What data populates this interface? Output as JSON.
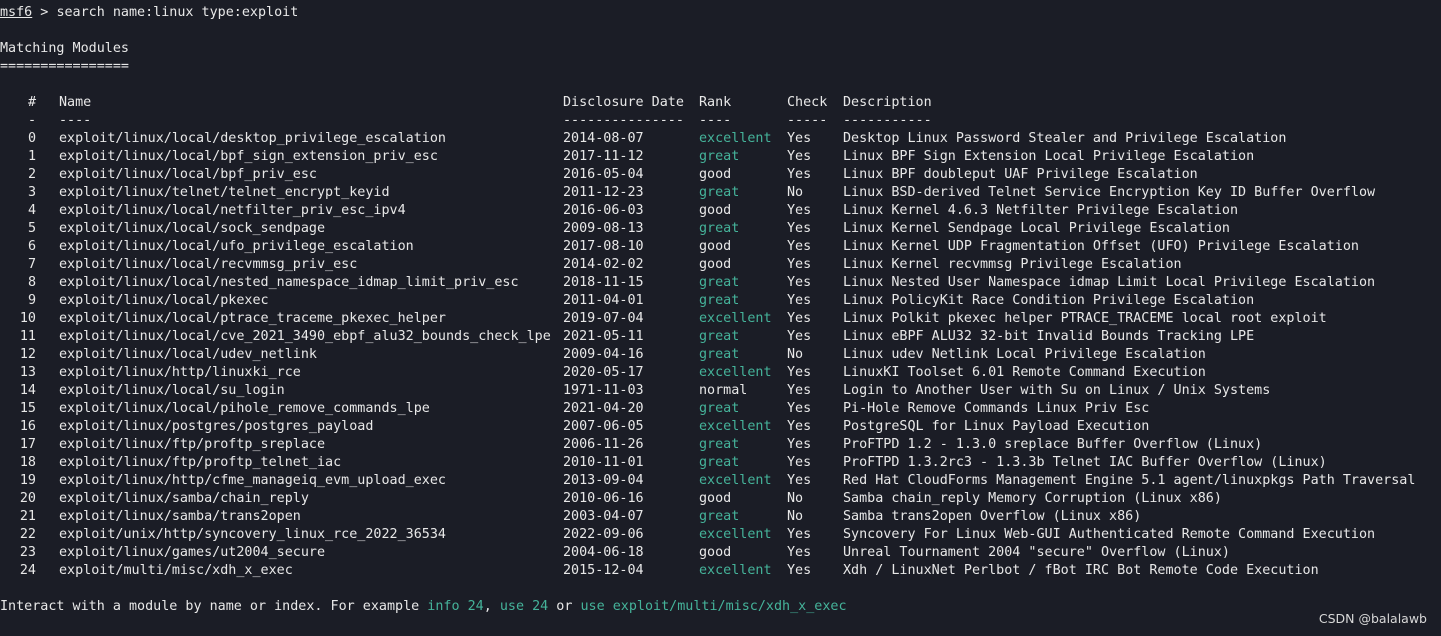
{
  "prompt": {
    "name": "msf6",
    "separator": " > ",
    "command": "search name:linux type:exploit"
  },
  "section": {
    "title": "Matching Modules",
    "underline": "================"
  },
  "table": {
    "headers": {
      "idx": "#",
      "name": "Name",
      "date": "Disclosure Date",
      "rank": "Rank",
      "check": "Check",
      "desc": "Description"
    },
    "dividers": {
      "idx": "-",
      "name": "----",
      "date": "---------------",
      "rank": "----",
      "check": "-----",
      "desc": "-----------"
    },
    "rows": [
      {
        "idx": "0",
        "name": "exploit/linux/local/desktop_privilege_escalation",
        "date": "2014-08-07",
        "rank": "excellent",
        "check": "Yes",
        "desc": "Desktop Linux Password Stealer and Privilege Escalation"
      },
      {
        "idx": "1",
        "name": "exploit/linux/local/bpf_sign_extension_priv_esc",
        "date": "2017-11-12",
        "rank": "great",
        "check": "Yes",
        "desc": "Linux BPF Sign Extension Local Privilege Escalation"
      },
      {
        "idx": "2",
        "name": "exploit/linux/local/bpf_priv_esc",
        "date": "2016-05-04",
        "rank": "good",
        "check": "Yes",
        "desc": "Linux BPF doubleput UAF Privilege Escalation"
      },
      {
        "idx": "3",
        "name": "exploit/linux/telnet/telnet_encrypt_keyid",
        "date": "2011-12-23",
        "rank": "great",
        "check": "No",
        "desc": "Linux BSD-derived Telnet Service Encryption Key ID Buffer Overflow"
      },
      {
        "idx": "4",
        "name": "exploit/linux/local/netfilter_priv_esc_ipv4",
        "date": "2016-06-03",
        "rank": "good",
        "check": "Yes",
        "desc": "Linux Kernel 4.6.3 Netfilter Privilege Escalation"
      },
      {
        "idx": "5",
        "name": "exploit/linux/local/sock_sendpage",
        "date": "2009-08-13",
        "rank": "great",
        "check": "Yes",
        "desc": "Linux Kernel Sendpage Local Privilege Escalation"
      },
      {
        "idx": "6",
        "name": "exploit/linux/local/ufo_privilege_escalation",
        "date": "2017-08-10",
        "rank": "good",
        "check": "Yes",
        "desc": "Linux Kernel UDP Fragmentation Offset (UFO) Privilege Escalation"
      },
      {
        "idx": "7",
        "name": "exploit/linux/local/recvmmsg_priv_esc",
        "date": "2014-02-02",
        "rank": "good",
        "check": "Yes",
        "desc": "Linux Kernel recvmmsg Privilege Escalation"
      },
      {
        "idx": "8",
        "name": "exploit/linux/local/nested_namespace_idmap_limit_priv_esc",
        "date": "2018-11-15",
        "rank": "great",
        "check": "Yes",
        "desc": "Linux Nested User Namespace idmap Limit Local Privilege Escalation"
      },
      {
        "idx": "9",
        "name": "exploit/linux/local/pkexec",
        "date": "2011-04-01",
        "rank": "great",
        "check": "Yes",
        "desc": "Linux PolicyKit Race Condition Privilege Escalation"
      },
      {
        "idx": "10",
        "name": "exploit/linux/local/ptrace_traceme_pkexec_helper",
        "date": "2019-07-04",
        "rank": "excellent",
        "check": "Yes",
        "desc": "Linux Polkit pkexec helper PTRACE_TRACEME local root exploit"
      },
      {
        "idx": "11",
        "name": "exploit/linux/local/cve_2021_3490_ebpf_alu32_bounds_check_lpe",
        "date": "2021-05-11",
        "rank": "great",
        "check": "Yes",
        "desc": "Linux eBPF ALU32 32-bit Invalid Bounds Tracking LPE"
      },
      {
        "idx": "12",
        "name": "exploit/linux/local/udev_netlink",
        "date": "2009-04-16",
        "rank": "great",
        "check": "No",
        "desc": "Linux udev Netlink Local Privilege Escalation"
      },
      {
        "idx": "13",
        "name": "exploit/linux/http/linuxki_rce",
        "date": "2020-05-17",
        "rank": "excellent",
        "check": "Yes",
        "desc": "LinuxKI Toolset 6.01 Remote Command Execution"
      },
      {
        "idx": "14",
        "name": "exploit/linux/local/su_login",
        "date": "1971-11-03",
        "rank": "normal",
        "check": "Yes",
        "desc": "Login to Another User with Su on Linux / Unix Systems"
      },
      {
        "idx": "15",
        "name": "exploit/linux/local/pihole_remove_commands_lpe",
        "date": "2021-04-20",
        "rank": "great",
        "check": "Yes",
        "desc": "Pi-Hole Remove Commands Linux Priv Esc"
      },
      {
        "idx": "16",
        "name": "exploit/linux/postgres/postgres_payload",
        "date": "2007-06-05",
        "rank": "excellent",
        "check": "Yes",
        "desc": "PostgreSQL for Linux Payload Execution"
      },
      {
        "idx": "17",
        "name": "exploit/linux/ftp/proftp_sreplace",
        "date": "2006-11-26",
        "rank": "great",
        "check": "Yes",
        "desc": "ProFTPD 1.2 - 1.3.0 sreplace Buffer Overflow (Linux)"
      },
      {
        "idx": "18",
        "name": "exploit/linux/ftp/proftp_telnet_iac",
        "date": "2010-11-01",
        "rank": "great",
        "check": "Yes",
        "desc": "ProFTPD 1.3.2rc3 - 1.3.3b Telnet IAC Buffer Overflow (Linux)"
      },
      {
        "idx": "19",
        "name": "exploit/linux/http/cfme_manageiq_evm_upload_exec",
        "date": "2013-09-04",
        "rank": "excellent",
        "check": "Yes",
        "desc": "Red Hat CloudForms Management Engine 5.1 agent/linuxpkgs Path Traversal"
      },
      {
        "idx": "20",
        "name": "exploit/linux/samba/chain_reply",
        "date": "2010-06-16",
        "rank": "good",
        "check": "No",
        "desc": "Samba chain_reply Memory Corruption (Linux x86)"
      },
      {
        "idx": "21",
        "name": "exploit/linux/samba/trans2open",
        "date": "2003-04-07",
        "rank": "great",
        "check": "No",
        "desc": "Samba trans2open Overflow (Linux x86)"
      },
      {
        "idx": "22",
        "name": "exploit/unix/http/syncovery_linux_rce_2022_36534",
        "date": "2022-09-06",
        "rank": "excellent",
        "check": "Yes",
        "desc": "Syncovery For Linux Web-GUI Authenticated Remote Command Execution"
      },
      {
        "idx": "23",
        "name": "exploit/linux/games/ut2004_secure",
        "date": "2004-06-18",
        "rank": "good",
        "check": "Yes",
        "desc": "Unreal Tournament 2004 \"secure\" Overflow (Linux)"
      },
      {
        "idx": "24",
        "name": "exploit/multi/misc/xdh_x_exec",
        "date": "2015-12-04",
        "rank": "excellent",
        "check": "Yes",
        "desc": "Xdh / LinuxNet Perlbot / fBot IRC Bot Remote Code Execution"
      }
    ]
  },
  "footer": {
    "text1": "Interact with a module by name or index. For example ",
    "cmd1": "info 24",
    "sep1": ", ",
    "cmd2": "use 24",
    "sep2": " or ",
    "cmd3": "use exploit/multi/misc/xdh_x_exec"
  },
  "watermark": "CSDN @balalawb",
  "colors": {
    "background": "#1b1d26",
    "text": "#e8e8e8",
    "accent_green": "#45b39a"
  }
}
